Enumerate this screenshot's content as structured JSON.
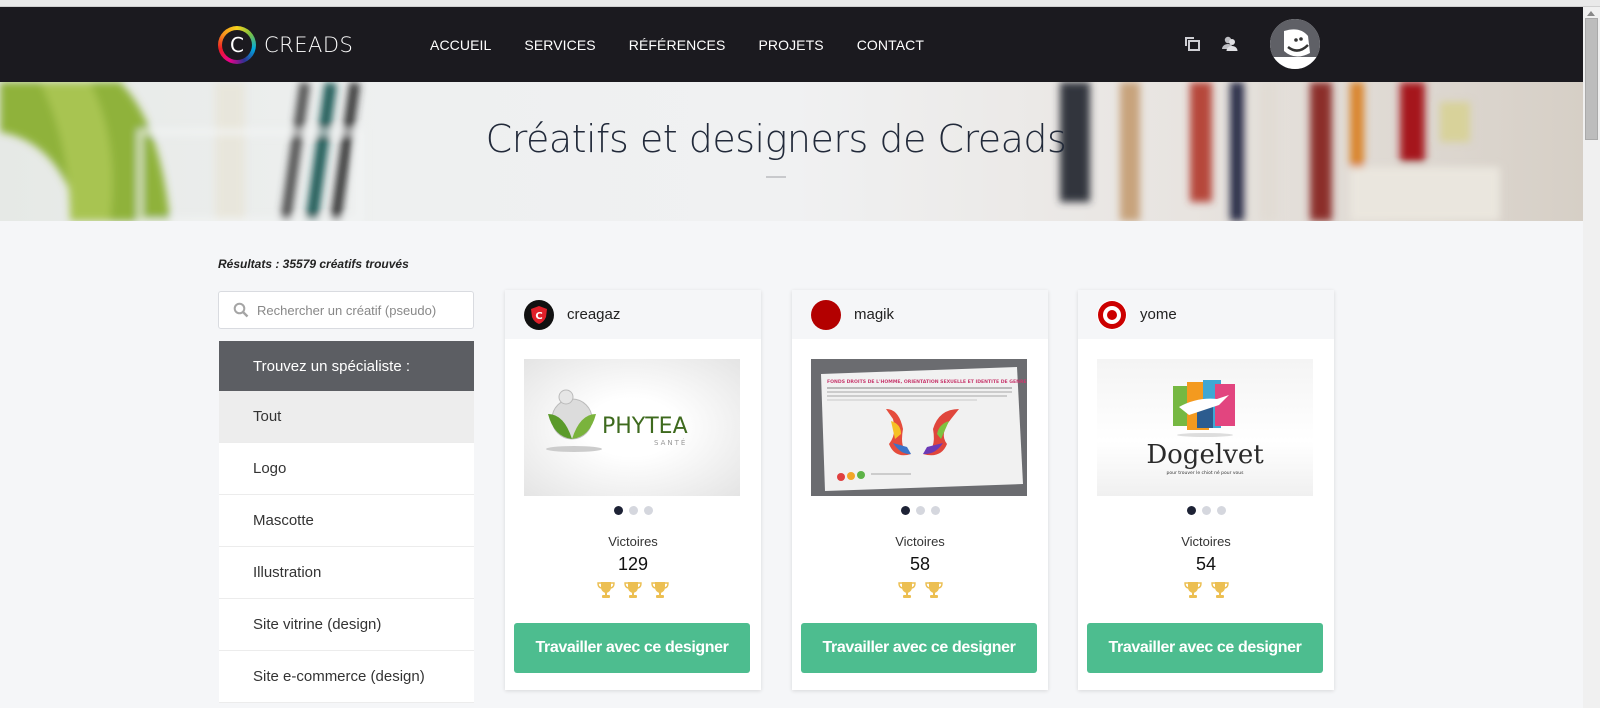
{
  "brand": {
    "name": "CREADS",
    "monogram": "C"
  },
  "nav": {
    "links": [
      "ACCUEIL",
      "SERVICES",
      "RÉFÉRENCES",
      "PROJETS",
      "CONTACT"
    ],
    "icons": [
      "windows-icon",
      "users-icon"
    ]
  },
  "hero": {
    "title": "Créatifs et designers de Creads"
  },
  "sidebar": {
    "results": "Résultats : 35579 créatifs trouvés",
    "search_placeholder": "Rechercher un créatif (pseudo)",
    "search_value": "",
    "specialist_header": "Trouvez un spécialiste :",
    "items": [
      {
        "label": "Tout",
        "active": true
      },
      {
        "label": "Logo",
        "active": false
      },
      {
        "label": "Mascotte",
        "active": false
      },
      {
        "label": "Illustration",
        "active": false
      },
      {
        "label": "Site vitrine (design)",
        "active": false
      },
      {
        "label": "Site e-commerce (design)",
        "active": false
      }
    ]
  },
  "cards": [
    {
      "name": "creagaz",
      "image_text": "PHYTEA",
      "image_subtext": "SANTÉ",
      "victoires_label": "Victoires",
      "victoires": "129",
      "trophies": 3,
      "active_slide": 1,
      "slides": 3,
      "cta": "Travailler avec ce designer"
    },
    {
      "name": "magik",
      "image_text": "FONDS DROITS DE L'HOMME, ORIENTATION SEXUELLE ET IDENTITE DE GENRE",
      "image_subtext": "",
      "victoires_label": "Victoires",
      "victoires": "58",
      "trophies": 2,
      "active_slide": 1,
      "slides": 3,
      "cta": "Travailler avec ce designer"
    },
    {
      "name": "yome",
      "image_text": "Dogelvet",
      "image_subtext": "pour trouver le chiot né pour vous",
      "victoires_label": "Victoires",
      "victoires": "54",
      "trophies": 2,
      "active_slide": 1,
      "slides": 3,
      "cta": "Travailler avec ce designer"
    }
  ],
  "colors": {
    "navbar": "#1b1a1f",
    "cta": "#4dbd8f",
    "trophy": "#ecbf52",
    "dot_active": "#1d2235"
  }
}
